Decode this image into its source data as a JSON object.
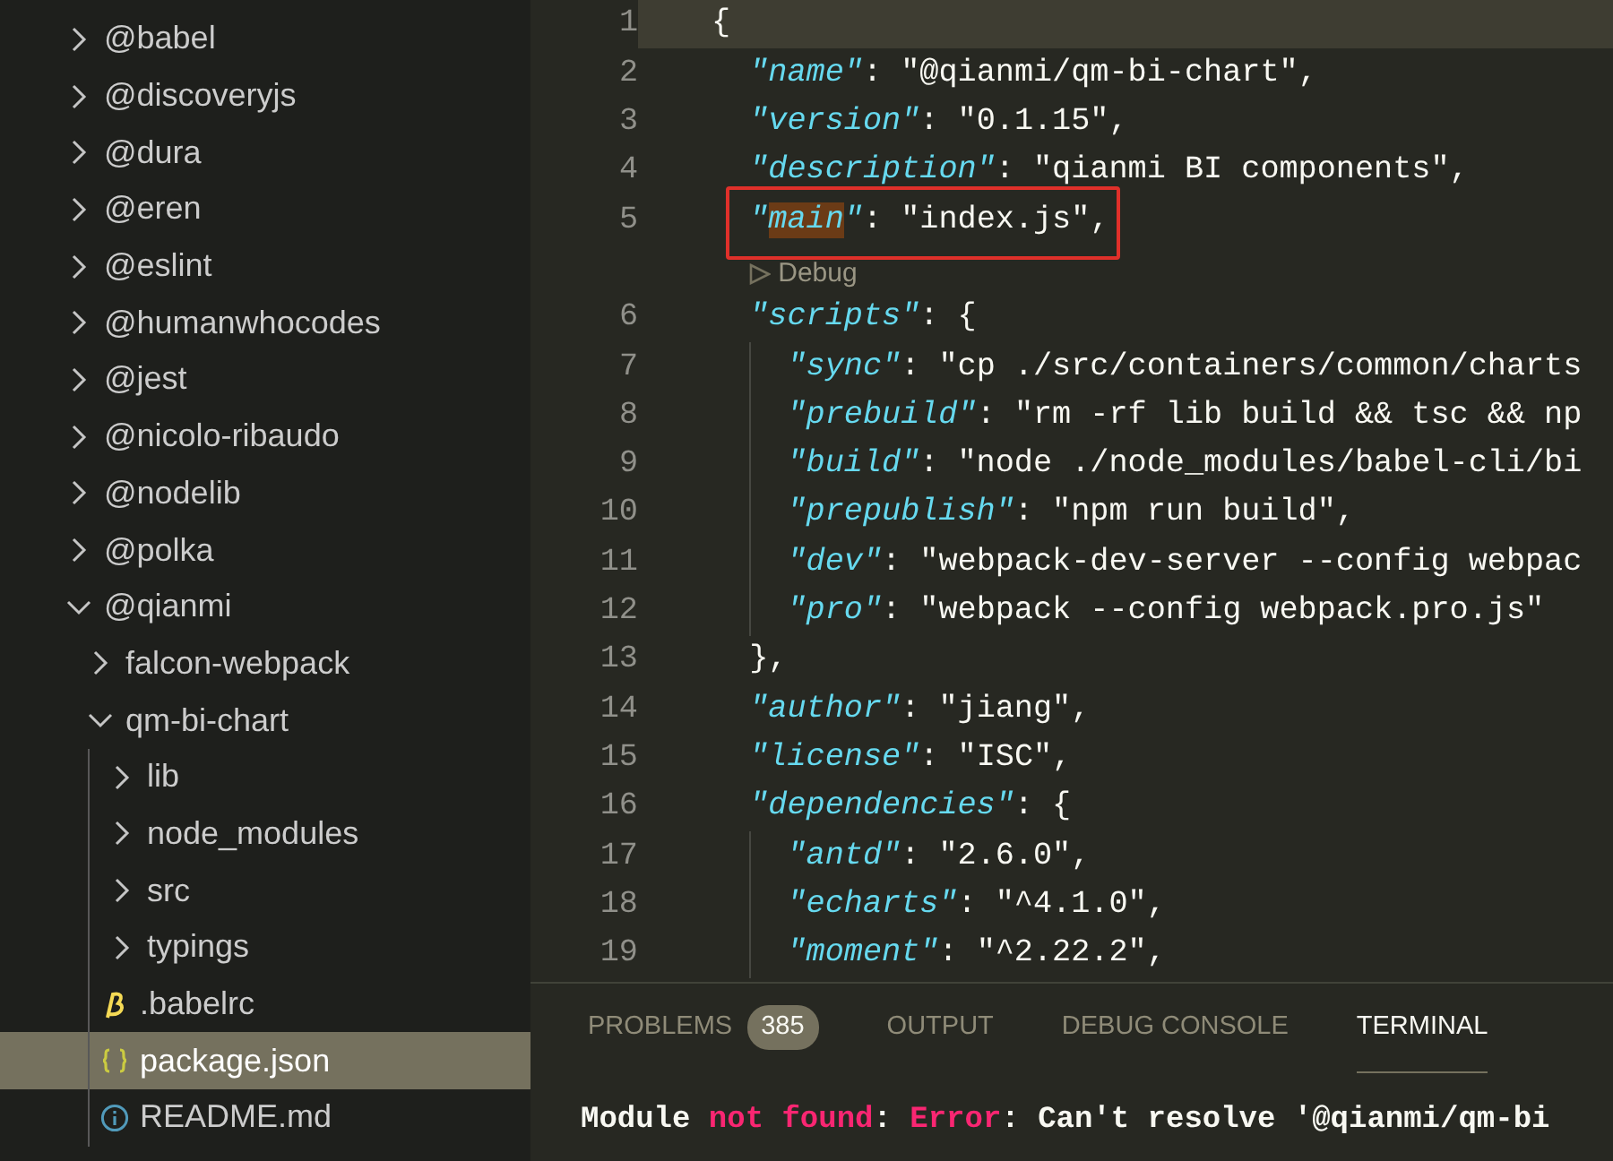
{
  "explorer": {
    "items": [
      {
        "label": "@babel",
        "kind": "folder",
        "expanded": false,
        "selected": false
      },
      {
        "label": "@discoveryjs",
        "kind": "folder",
        "expanded": false,
        "selected": false
      },
      {
        "label": "@dura",
        "kind": "folder",
        "expanded": false,
        "selected": false
      },
      {
        "label": "@eren",
        "kind": "folder",
        "expanded": false,
        "selected": false
      },
      {
        "label": "@eslint",
        "kind": "folder",
        "expanded": false,
        "selected": false
      },
      {
        "label": "@humanwhocodes",
        "kind": "folder",
        "expanded": false,
        "selected": false
      },
      {
        "label": "@jest",
        "kind": "folder",
        "expanded": false,
        "selected": false
      },
      {
        "label": "@nicolo-ribaudo",
        "kind": "folder",
        "expanded": false,
        "selected": false
      },
      {
        "label": "@nodelib",
        "kind": "folder",
        "expanded": false,
        "selected": false
      },
      {
        "label": "@polka",
        "kind": "folder",
        "expanded": false,
        "selected": false
      },
      {
        "label": "@qianmi",
        "kind": "folder",
        "expanded": true,
        "selected": false,
        "children": [
          {
            "label": "falcon-webpack",
            "kind": "folder",
            "expanded": false,
            "selected": false
          },
          {
            "label": "qm-bi-chart",
            "kind": "folder",
            "expanded": true,
            "selected": false,
            "children": [
              {
                "label": "lib",
                "kind": "folder",
                "expanded": false,
                "selected": false
              },
              {
                "label": "node_modules",
                "kind": "folder",
                "expanded": false,
                "selected": false
              },
              {
                "label": "src",
                "kind": "folder",
                "expanded": false,
                "selected": false
              },
              {
                "label": "typings",
                "kind": "folder",
                "expanded": false,
                "selected": false
              },
              {
                "label": ".babelrc",
                "kind": "babel-file",
                "selected": false
              },
              {
                "label": "package.json",
                "kind": "json-file",
                "selected": true
              },
              {
                "label": "README.md",
                "kind": "info-file",
                "selected": false
              }
            ]
          }
        ]
      }
    ]
  },
  "editor": {
    "lines": [
      {
        "kind": "code",
        "number": "1",
        "current": true,
        "boxed": false,
        "tokens": [
          {
            "kind": "punct",
            "text": "{"
          }
        ]
      },
      {
        "kind": "code",
        "number": "2",
        "current": false,
        "boxed": false,
        "tokens": [
          {
            "kind": "key",
            "text": "  \"name\""
          },
          {
            "kind": "punct",
            "text": ": "
          },
          {
            "kind": "string",
            "text": "\"@qianmi/qm-bi-chart\""
          },
          {
            "kind": "punct",
            "text": ","
          }
        ]
      },
      {
        "kind": "code",
        "number": "3",
        "current": false,
        "boxed": false,
        "tokens": [
          {
            "kind": "key",
            "text": "  \"version\""
          },
          {
            "kind": "punct",
            "text": ": "
          },
          {
            "kind": "string",
            "text": "\"0.1.15\""
          },
          {
            "kind": "punct",
            "text": ","
          }
        ]
      },
      {
        "kind": "code",
        "number": "4",
        "current": false,
        "boxed": false,
        "tokens": [
          {
            "kind": "key",
            "text": "  \"description\""
          },
          {
            "kind": "punct",
            "text": ": "
          },
          {
            "kind": "string",
            "text": "\"qianmi BI components\""
          },
          {
            "kind": "punct",
            "text": ","
          }
        ]
      },
      {
        "kind": "code",
        "number": "5",
        "current": false,
        "boxed": true,
        "tokens": [
          {
            "kind": "key",
            "text": "  \""
          },
          {
            "kind": "key",
            "text": "main",
            "highlighted": true
          },
          {
            "kind": "key",
            "text": "\""
          },
          {
            "kind": "punct",
            "text": ": "
          },
          {
            "kind": "string",
            "text": "\"index.js\""
          },
          {
            "kind": "punct",
            "text": ","
          }
        ]
      },
      {
        "kind": "codelens",
        "text": "Debug"
      },
      {
        "kind": "code",
        "number": "6",
        "current": false,
        "boxed": false,
        "tokens": [
          {
            "kind": "key",
            "text": "  \"scripts\""
          },
          {
            "kind": "punct",
            "text": ": {"
          }
        ]
      },
      {
        "kind": "code",
        "number": "7",
        "current": false,
        "boxed": false,
        "tokens": [
          {
            "kind": "key",
            "text": "    \"sync\""
          },
          {
            "kind": "punct",
            "text": ": "
          },
          {
            "kind": "string",
            "text": "\"cp ./src/containers/common/charts"
          }
        ]
      },
      {
        "kind": "code",
        "number": "8",
        "current": false,
        "boxed": false,
        "tokens": [
          {
            "kind": "key",
            "text": "    \"prebuild\""
          },
          {
            "kind": "punct",
            "text": ": "
          },
          {
            "kind": "string",
            "text": "\"rm -rf lib build && tsc && np"
          }
        ]
      },
      {
        "kind": "code",
        "number": "9",
        "current": false,
        "boxed": false,
        "tokens": [
          {
            "kind": "key",
            "text": "    \"build\""
          },
          {
            "kind": "punct",
            "text": ": "
          },
          {
            "kind": "string",
            "text": "\"node ./node_modules/babel-cli/bi"
          }
        ]
      },
      {
        "kind": "code",
        "number": "10",
        "current": false,
        "boxed": false,
        "tokens": [
          {
            "kind": "key",
            "text": "    \"prepublish\""
          },
          {
            "kind": "punct",
            "text": ": "
          },
          {
            "kind": "string",
            "text": "\"npm run build\""
          },
          {
            "kind": "punct",
            "text": ","
          }
        ]
      },
      {
        "kind": "code",
        "number": "11",
        "current": false,
        "boxed": false,
        "tokens": [
          {
            "kind": "key",
            "text": "    \"dev\""
          },
          {
            "kind": "punct",
            "text": ": "
          },
          {
            "kind": "string",
            "text": "\"webpack-dev-server --config webpac"
          }
        ]
      },
      {
        "kind": "code",
        "number": "12",
        "current": false,
        "boxed": false,
        "tokens": [
          {
            "kind": "key",
            "text": "    \"pro\""
          },
          {
            "kind": "punct",
            "text": ": "
          },
          {
            "kind": "string",
            "text": "\"webpack --config webpack.pro.js\""
          }
        ]
      },
      {
        "kind": "code",
        "number": "13",
        "current": false,
        "boxed": false,
        "tokens": [
          {
            "kind": "punct",
            "text": "  },"
          }
        ]
      },
      {
        "kind": "code",
        "number": "14",
        "current": false,
        "boxed": false,
        "tokens": [
          {
            "kind": "key",
            "text": "  \"author\""
          },
          {
            "kind": "punct",
            "text": ": "
          },
          {
            "kind": "string",
            "text": "\"jiang\""
          },
          {
            "kind": "punct",
            "text": ","
          }
        ]
      },
      {
        "kind": "code",
        "number": "15",
        "current": false,
        "boxed": false,
        "tokens": [
          {
            "kind": "key",
            "text": "  \"license\""
          },
          {
            "kind": "punct",
            "text": ": "
          },
          {
            "kind": "string",
            "text": "\"ISC\""
          },
          {
            "kind": "punct",
            "text": ","
          }
        ]
      },
      {
        "kind": "code",
        "number": "16",
        "current": false,
        "boxed": false,
        "tokens": [
          {
            "kind": "key",
            "text": "  \"dependencies\""
          },
          {
            "kind": "punct",
            "text": ": {"
          }
        ]
      },
      {
        "kind": "code",
        "number": "17",
        "current": false,
        "boxed": false,
        "tokens": [
          {
            "kind": "key",
            "text": "    \"antd\""
          },
          {
            "kind": "punct",
            "text": ": "
          },
          {
            "kind": "string",
            "text": "\"2.6.0\""
          },
          {
            "kind": "punct",
            "text": ","
          }
        ]
      },
      {
        "kind": "code",
        "number": "18",
        "current": false,
        "boxed": false,
        "tokens": [
          {
            "kind": "key",
            "text": "    \"echarts\""
          },
          {
            "kind": "punct",
            "text": ": "
          },
          {
            "kind": "string",
            "text": "\"^4.1.0\""
          },
          {
            "kind": "punct",
            "text": ","
          }
        ]
      },
      {
        "kind": "code",
        "number": "19",
        "current": false,
        "boxed": false,
        "tokens": [
          {
            "kind": "key",
            "text": "    \"moment\""
          },
          {
            "kind": "punct",
            "text": ": "
          },
          {
            "kind": "string",
            "text": "\"^2.22.2\""
          },
          {
            "kind": "punct",
            "text": ","
          }
        ]
      }
    ]
  },
  "panel": {
    "tabs": [
      {
        "label": "PROBLEMS",
        "badge": "385",
        "selected": false
      },
      {
        "label": "OUTPUT",
        "selected": false
      },
      {
        "label": "DEBUG CONSOLE",
        "selected": false
      },
      {
        "label": "TERMINAL",
        "selected": true
      }
    ],
    "terminal": {
      "lines": [
        {
          "tokens": [
            {
              "kind": "plain",
              "text": "Module "
            },
            {
              "kind": "error",
              "text": "not found"
            },
            {
              "kind": "plain",
              "text": ": "
            },
            {
              "kind": "error",
              "text": "Error"
            },
            {
              "kind": "plain",
              "text": ": Can't resolve '@qianmi/qm-bi"
            }
          ]
        }
      ]
    }
  }
}
